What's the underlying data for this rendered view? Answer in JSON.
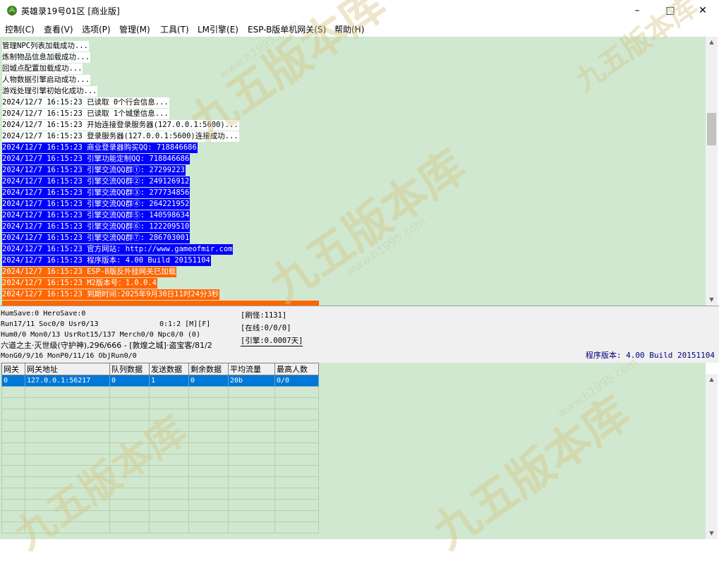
{
  "window": {
    "title": "英雄录19号01区 [商业版]",
    "minimize_icon": "minimize-icon",
    "maximize_icon": "maximize-icon",
    "close_icon": "close-icon"
  },
  "menu": [
    {
      "label": "控制(C)"
    },
    {
      "label": "查看(V)"
    },
    {
      "label": "选项(P)"
    },
    {
      "label": "管理(M)"
    },
    {
      "label": "工具(T)"
    },
    {
      "label": "LM引擎(E)"
    },
    {
      "label": "ESP-B版单机网关(S)"
    },
    {
      "label": "帮助(H)"
    }
  ],
  "colors": {
    "log_background": "#cfe8cf",
    "line_white": "#ffffff",
    "line_blue": "#0000ff",
    "line_orange": "#ff6600",
    "version_text": "#000080",
    "selected_row": "#0078d7"
  },
  "log": {
    "lines": [
      {
        "text": "管理NPC列表加载成功...",
        "style": "white"
      },
      {
        "text": "炼制物品信息加载成功...",
        "style": "white"
      },
      {
        "text": "回城点配置加载成功...",
        "style": "white"
      },
      {
        "text": "人物数据引擎启动成功...",
        "style": "white"
      },
      {
        "text": "游戏处理引擎初始化成功...",
        "style": "white"
      },
      {
        "text": "2024/12/7 16:15:23 已读取 0个行会信息...",
        "style": "white"
      },
      {
        "text": "2024/12/7 16:15:23 已读取 1个城堡信息...",
        "style": "white"
      },
      {
        "text": "2024/12/7 16:15:23 开始连接登录服务器(127.0.0.1:5600)...",
        "style": "white"
      },
      {
        "text": "2024/12/7 16:15:23 登录服务器(127.0.0.1:5600)连接成功...",
        "style": "white"
      },
      {
        "text": "2024/12/7 16:15:23 商业登录器购买QQ: 718846686",
        "style": "blue"
      },
      {
        "text": "2024/12/7 16:15:23 引擎功能定制QQ: 718846686",
        "style": "blue"
      },
      {
        "text": "2024/12/7 16:15:23 引擎交流QQ群①: 27299223",
        "style": "blue"
      },
      {
        "text": "2024/12/7 16:15:23 引擎交流QQ群②: 249126912",
        "style": "blue"
      },
      {
        "text": "2024/12/7 16:15:23 引擎交流QQ群③: 277734856",
        "style": "blue"
      },
      {
        "text": "2024/12/7 16:15:23 引擎交流QQ群④: 264221952",
        "style": "blue"
      },
      {
        "text": "2024/12/7 16:15:23 引擎交流QQ群⑤: 140598634",
        "style": "blue"
      },
      {
        "text": "2024/12/7 16:15:23 引擎交流QQ群⑥: 122209510",
        "style": "blue"
      },
      {
        "text": "2024/12/7 16:15:23 引擎交流QQ群⑦: 286703001",
        "style": "blue"
      },
      {
        "text": "2024/12/7 16:15:23 官方网站: http://www.gameofmir.com",
        "style": "blue"
      },
      {
        "text": "2024/12/7 16:15:23 程序版本: 4.00 Build 20151104",
        "style": "blue"
      },
      {
        "text": "2024/12/7 16:15:23 ESP-B版反外挂网关已加载",
        "style": "orange"
      },
      {
        "text": "2024/12/7 16:15:23 M2版本号：1.0.0.4",
        "style": "orange"
      },
      {
        "text": "2024/12/7 16:15:23 到期时间:2025年9月30日11时24分3秒",
        "style": "orange"
      }
    ]
  },
  "status": {
    "line1": "HumSave:0 HeroSave:0",
    "line2": "Run17/11 Soc0/0 Usr0/13",
    "time": "0:1:2 [M][F]",
    "line3": "Hum0/0 Mon0/13 UsrRot15/137 Merch0/0 Npc0/0 (0)",
    "line4": "六道之主·灭世级(守护神),296/666 - [敦煌之城]·盗宝客/81/2",
    "line5": "MonG0/9/16 MonP0/11/16 ObjRun0/0",
    "refresh": "[刷怪:1131]",
    "online": "[在线:0/0/0]",
    "engine": "[引擎:0.0007天]",
    "version": "程序版本: 4.00 Build 20151104"
  },
  "gateway_table": {
    "columns": [
      "网关",
      "网关地址",
      "队列数据",
      "发送数据",
      "剩余数据",
      "平均流量",
      "最高人数"
    ],
    "rows": [
      [
        "0",
        "127.0.0.1:56217",
        "0",
        "1",
        "0",
        "20b",
        "0/0"
      ]
    ]
  },
  "watermark": {
    "text": "九五版本库",
    "url": "www.h1995.com"
  }
}
